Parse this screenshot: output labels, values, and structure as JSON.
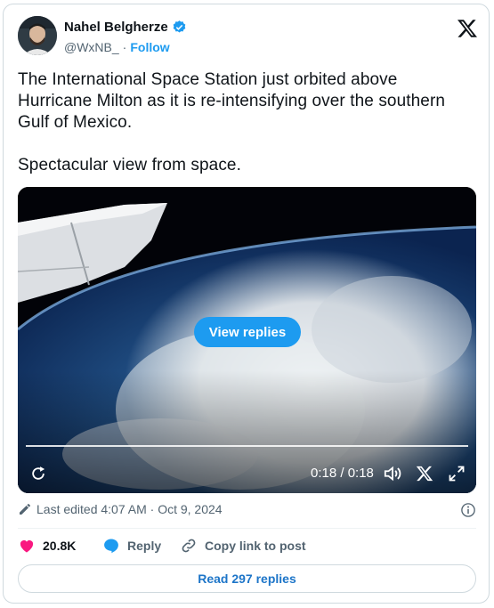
{
  "author": {
    "name": "Nahel Belgherze",
    "handle": "@WxNB_",
    "separator": "·",
    "follow_label": "Follow"
  },
  "tweet": {
    "text": "The International Space Station just orbited above Hurricane Milton as it is re-intensifying over the southern Gulf of Mexico.\n\nSpectacular view from space."
  },
  "media": {
    "view_replies_label": "View replies",
    "timecode": "0:18 / 0:18",
    "progress_fraction": 1.0
  },
  "meta": {
    "edited_text": "Last edited 4:07 AM · Oct 9, 2024"
  },
  "actions": {
    "likes": "20.8K",
    "reply_label": "Reply",
    "copy_label": "Copy link to post"
  },
  "read_replies_label": "Read 297 replies",
  "colors": {
    "accent": "#1d9bf0",
    "like": "#f91880",
    "text_secondary": "#536471"
  },
  "icons": [
    "verified-badge-icon",
    "x-logo-icon",
    "replay-icon",
    "volume-icon",
    "x-watermark-icon",
    "fullscreen-icon",
    "edit-pencil-icon",
    "info-icon",
    "heart-icon",
    "reply-bubble-icon",
    "link-icon"
  ]
}
